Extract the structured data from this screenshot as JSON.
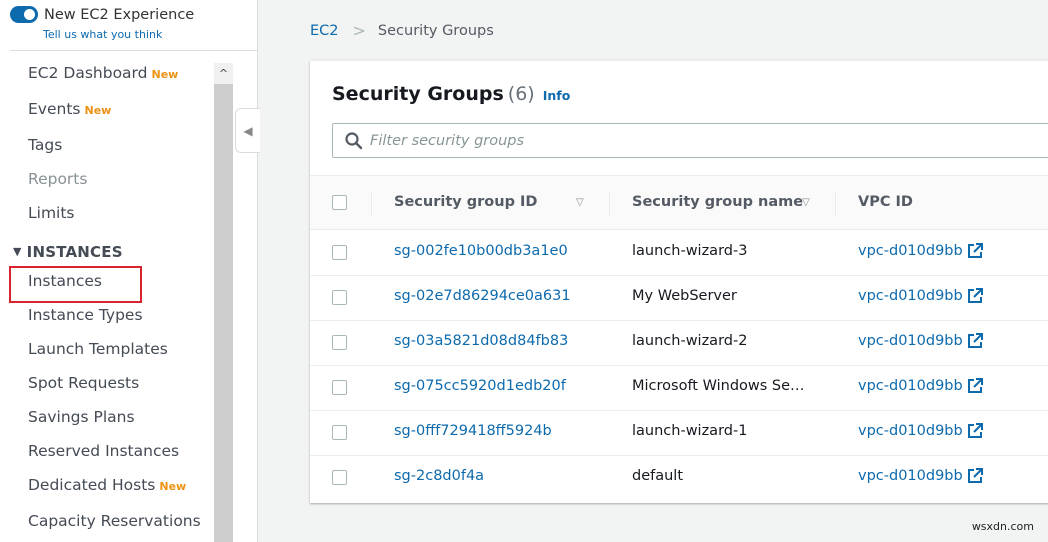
{
  "sidebar": {
    "experience_toggle": {
      "label": "New EC2 Experience",
      "enabled": true,
      "feedback_link": "Tell us what you think"
    },
    "items": [
      {
        "label": "EC2 Dashboard",
        "badge": "New"
      },
      {
        "label": "Events",
        "badge": "New"
      },
      {
        "label": "Tags",
        "badge": ""
      },
      {
        "label": "Reports",
        "badge": "",
        "disabled": true
      },
      {
        "label": "Limits",
        "badge": ""
      }
    ],
    "section": {
      "label": "INSTANCES",
      "expanded_icon": "triangle-down-icon"
    },
    "instances_items": [
      {
        "label": "Instances",
        "badge": "",
        "highlighted": true
      },
      {
        "label": "Instance Types",
        "badge": ""
      },
      {
        "label": "Launch Templates",
        "badge": ""
      },
      {
        "label": "Spot Requests",
        "badge": ""
      },
      {
        "label": "Savings Plans",
        "badge": ""
      },
      {
        "label": "Reserved Instances",
        "badge": ""
      },
      {
        "label": "Dedicated Hosts",
        "badge": "New"
      },
      {
        "label": "Capacity Reservations",
        "badge": ""
      }
    ],
    "scroll_up_glyph": "^",
    "collapse_glyph": "◀"
  },
  "breadcrumb": {
    "root": "EC2",
    "separator": ">",
    "current": "Security Groups"
  },
  "panel": {
    "title": "Security Groups",
    "count": "(6)",
    "info": "Info",
    "search": {
      "placeholder": "Filter security groups",
      "value": ""
    }
  },
  "table": {
    "columns": [
      {
        "label": "Security group ID",
        "sortable": true
      },
      {
        "label": "Security group name",
        "sortable": true
      },
      {
        "label": "VPC ID",
        "sortable": false
      }
    ],
    "sort_glyph": "▽",
    "rows": [
      {
        "id": "sg-002fe10b00db3a1e0",
        "name": "launch-wizard-3",
        "vpc": "vpc-d010d9bb"
      },
      {
        "id": "sg-02e7d86294ce0a631",
        "name": "My WebServer",
        "vpc": "vpc-d010d9bb"
      },
      {
        "id": "sg-03a5821d08d84fb83",
        "name": "launch-wizard-2",
        "vpc": "vpc-d010d9bb"
      },
      {
        "id": "sg-075cc5920d1edb20f",
        "name": "Microsoft Windows Se…",
        "vpc": "vpc-d010d9bb"
      },
      {
        "id": "sg-0fff729418ff5924b",
        "name": "launch-wizard-1",
        "vpc": "vpc-d010d9bb"
      },
      {
        "id": "sg-2c8d0f4a",
        "name": "default",
        "vpc": "vpc-d010d9bb"
      }
    ]
  },
  "colors": {
    "link": "#0d6aad",
    "badge_new": "#ec9214",
    "highlight_box": "#d9232e"
  },
  "watermark": "wsxdn.com"
}
